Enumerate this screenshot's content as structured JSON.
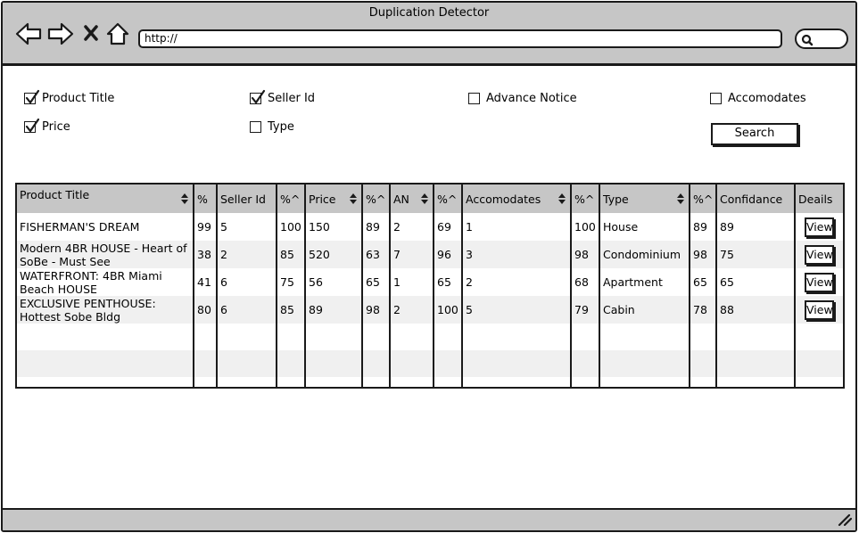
{
  "window": {
    "title": "Duplication Detector"
  },
  "browser": {
    "url": "http://",
    "icons": [
      "back-arrow-icon",
      "forward-arrow-icon",
      "close-x-icon",
      "home-icon",
      "search-icon"
    ]
  },
  "filters": {
    "product_title": {
      "label": "Product Title",
      "checked": true
    },
    "seller_id": {
      "label": "Seller Id",
      "checked": true
    },
    "advance_notice": {
      "label": "Advance Notice",
      "checked": false
    },
    "accomodates": {
      "label": "Accomodates",
      "checked": false
    },
    "price": {
      "label": "Price",
      "checked": true
    },
    "type": {
      "label": "Type",
      "checked": false
    },
    "search_label": "Search"
  },
  "table": {
    "headers": {
      "product_title": "Product Title",
      "pct1": "%",
      "seller_id": "Seller Id",
      "pct2": "%^",
      "price": "Price",
      "pct3": "%^",
      "an": "AN",
      "pct4": "%^",
      "accomodates": "Accomodates",
      "pct5": "%^",
      "type": "Type",
      "pct6": "%^",
      "confidance": "Confidance",
      "deails": "Deails"
    },
    "rows": [
      {
        "title": "FISHERMAN'S DREAM",
        "p1": "99",
        "seller": "5",
        "p2": "100",
        "price": "150",
        "p3": "89",
        "an": "2",
        "p4": "69",
        "acc": "1",
        "p5": "100",
        "type": "House",
        "p6": "89",
        "conf": "89",
        "action": "View"
      },
      {
        "title": "Modern 4BR HOUSE - Heart of SoBe - Must See",
        "p1": "38",
        "seller": "2",
        "p2": "85",
        "price": "520",
        "p3": "63",
        "an": "7",
        "p4": "96",
        "acc": "3",
        "p5": "98",
        "type": "Condominium",
        "p6": "98",
        "conf": "75",
        "action": "View"
      },
      {
        "title": "WATERFRONT: 4BR Miami Beach HOUSE",
        "p1": "41",
        "seller": "6",
        "p2": "75",
        "price": "56",
        "p3": "65",
        "an": "1",
        "p4": "65",
        "acc": "2",
        "p5": "68",
        "type": "Apartment",
        "p6": "65",
        "conf": "65",
        "action": "View"
      },
      {
        "title": "EXCLUSIVE PENTHOUSE: Hottest Sobe Bldg",
        "p1": "80",
        "seller": "6",
        "p2": "85",
        "price": "89",
        "p3": "98",
        "an": "2",
        "p4": "100",
        "acc": "5",
        "p5": "79",
        "type": "Cabin",
        "p6": "78",
        "conf": "88",
        "action": "View"
      }
    ]
  }
}
